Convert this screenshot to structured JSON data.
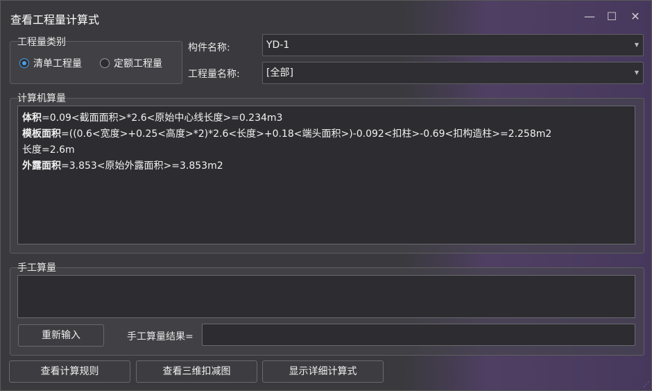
{
  "window": {
    "title": "查看工程量计算式",
    "minimize_glyph": "—",
    "maximize_glyph": "☐",
    "close_glyph": "✕"
  },
  "quantity_type": {
    "group_label": "工程量类别",
    "options": [
      {
        "label": "清单工程量",
        "selected": true
      },
      {
        "label": "定额工程量",
        "selected": false
      }
    ]
  },
  "component": {
    "label": "构件名称:",
    "value": "YD-1"
  },
  "quantity_name": {
    "label": "工程量名称:",
    "value": "[全部]"
  },
  "computer_calc": {
    "group_label": "计算机算量",
    "lines": [
      {
        "key": "体积",
        "expr": "=0.09<截面面积>*2.6<原始中心线长度>=0.234m3"
      },
      {
        "key": "模板面积",
        "expr": "=((0.6<宽度>+0.25<高度>*2)*2.6<长度>+0.18<端头面积>)-0.092<扣柱>-0.69<扣构造柱>=2.258m2"
      },
      {
        "key": "",
        "expr": "长度=2.6m"
      },
      {
        "key": "外露面积",
        "expr": "=3.853<原始外露面积>=3.853m2"
      }
    ]
  },
  "manual_calc": {
    "group_label": "手工算量",
    "reenter_button": "重新输入",
    "result_label": "手工算量结果=",
    "result_value": ""
  },
  "footer": {
    "view_rules": "查看计算规则",
    "view_3d": "查看三维扣减图",
    "show_detail": "显示详细计算式"
  },
  "colors": {
    "accent": "#4a9fe6",
    "background": "#3a3a3e",
    "field_bg": "#2d2d31"
  }
}
